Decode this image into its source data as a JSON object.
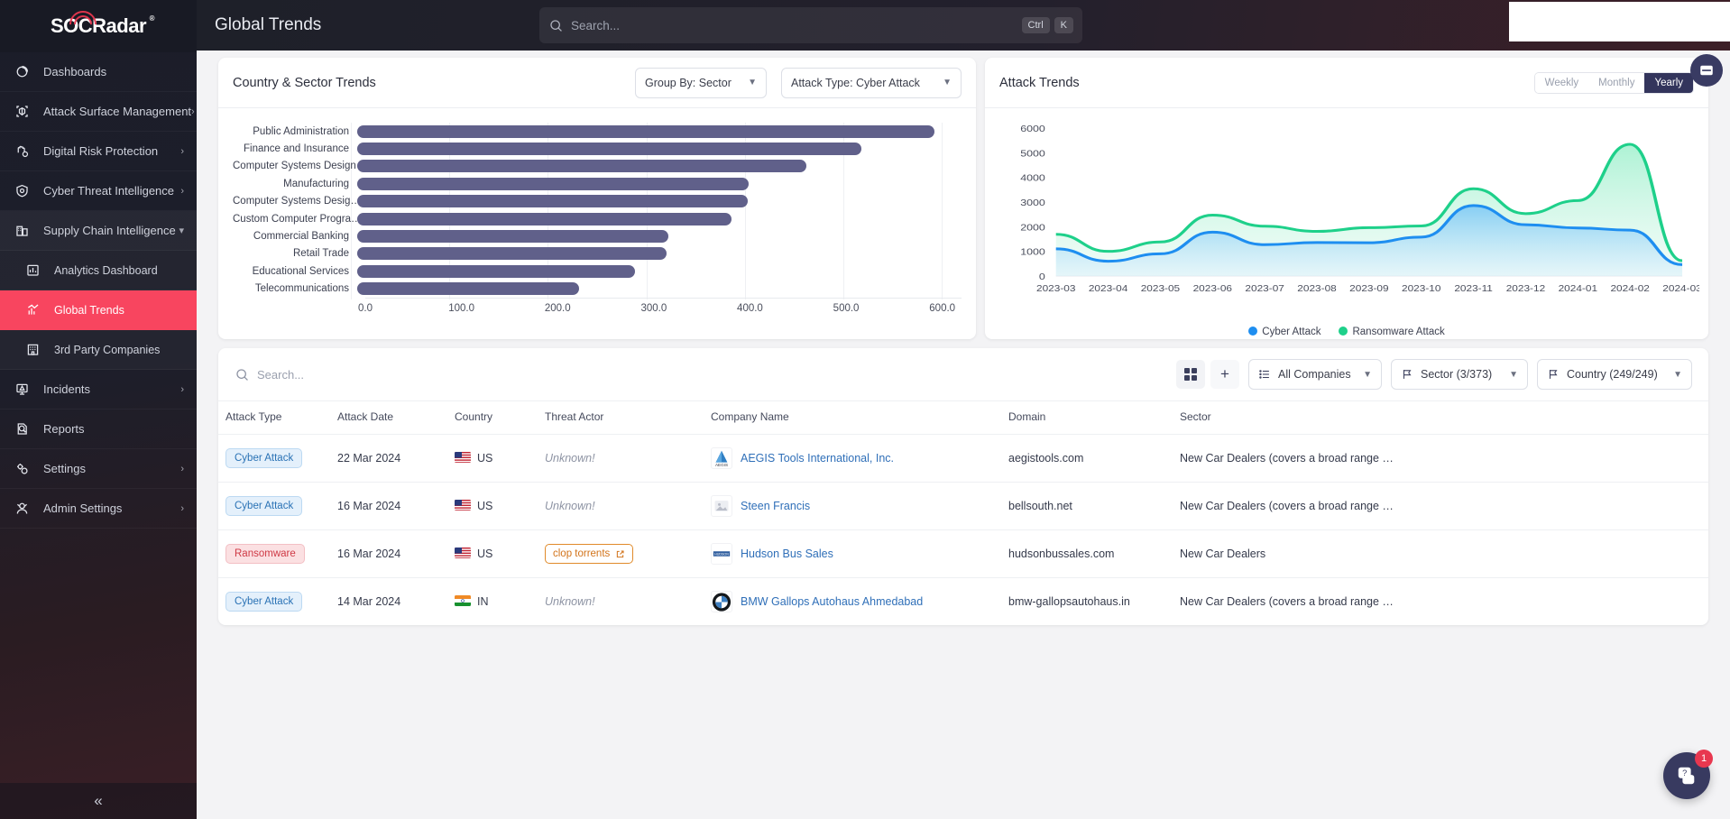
{
  "brand": {
    "name": "SOCRadar",
    "reg": "®",
    "accent": "#f8455f"
  },
  "topbar": {
    "page_title": "Global Trends",
    "search_placeholder": "Search...",
    "kbd_ctrl": "Ctrl",
    "kbd_k": "K"
  },
  "sidebar": {
    "collapse_glyph": "«",
    "items": [
      {
        "label": "Dashboards",
        "icon": "dashboard-icon",
        "chevron": "",
        "state": ""
      },
      {
        "label": "Attack Surface Management",
        "icon": "asm-icon",
        "chevron": "›",
        "state": ""
      },
      {
        "label": "Digital Risk Protection",
        "icon": "drp-icon",
        "chevron": "›",
        "state": ""
      },
      {
        "label": "Cyber Threat Intelligence",
        "icon": "cti-icon",
        "chevron": "›",
        "state": ""
      },
      {
        "label": "Supply Chain Intelligence",
        "icon": "supply-icon",
        "chevron": "⌄",
        "state": "open"
      },
      {
        "label": "Analytics Dashboard",
        "icon": "analytics-icon",
        "chevron": "",
        "state": "child"
      },
      {
        "label": "Global Trends",
        "icon": "trends-icon",
        "chevron": "",
        "state": "child active"
      },
      {
        "label": "3rd Party Companies",
        "icon": "companies-icon",
        "chevron": "",
        "state": "child"
      },
      {
        "label": "Incidents",
        "icon": "incidents-icon",
        "chevron": "›",
        "state": ""
      },
      {
        "label": "Reports",
        "icon": "reports-icon",
        "chevron": "",
        "state": ""
      },
      {
        "label": "Settings",
        "icon": "settings-icon",
        "chevron": "›",
        "state": ""
      },
      {
        "label": "Admin Settings",
        "icon": "admin-icon",
        "chevron": "›",
        "state": ""
      }
    ]
  },
  "sector_card": {
    "title": "Country & Sector Trends",
    "group_by": "Group By: Sector",
    "attack_type": "Attack Type: Cyber Attack"
  },
  "trends_card": {
    "title": "Attack Trends",
    "ranges": [
      {
        "label": "Weekly",
        "active": false
      },
      {
        "label": "Monthly",
        "active": false
      },
      {
        "label": "Yearly",
        "active": true
      }
    ]
  },
  "filterbar": {
    "search_placeholder": "Search...",
    "grid_button": "grid-view-button",
    "add_button": "+",
    "all_companies": "All Companies",
    "sector_filter": "Sector (3/373)",
    "country_filter": "Country (249/249)"
  },
  "table": {
    "columns": [
      "Attack Type",
      "Attack Date",
      "Country",
      "Threat Actor",
      "Company Name",
      "Domain",
      "Sector"
    ],
    "rows": [
      {
        "attack_type": "Cyber Attack",
        "attack_kind": "cyber",
        "attack_date": "22 Mar 2024",
        "country": "US",
        "flag": "us",
        "threat_actor": "Unknown!",
        "actor_known": false,
        "company": "AEGIS Tools International, Inc.",
        "logo": "AEGIS",
        "domain": "aegistools.com",
        "sector": "New Car Dealers (covers a broad range …"
      },
      {
        "attack_type": "Cyber Attack",
        "attack_kind": "cyber",
        "attack_date": "16 Mar 2024",
        "country": "US",
        "flag": "us",
        "threat_actor": "Unknown!",
        "actor_known": false,
        "company": "Steen Francis",
        "logo": "",
        "domain": "bellsouth.net",
        "sector": "New Car Dealers (covers a broad range …"
      },
      {
        "attack_type": "Ransomware",
        "attack_kind": "ransom",
        "attack_date": "16 Mar 2024",
        "country": "US",
        "flag": "us",
        "threat_actor": "clop torrents",
        "actor_known": true,
        "company": "Hudson Bus Sales",
        "logo": "HUDSON",
        "domain": "hudsonbussales.com",
        "sector": "New Car Dealers"
      },
      {
        "attack_type": "Cyber Attack",
        "attack_kind": "cyber",
        "attack_date": "14 Mar 2024",
        "country": "IN",
        "flag": "in",
        "threat_actor": "Unknown!",
        "actor_known": false,
        "company": "BMW Gallops Autohaus Ahmedabad",
        "logo": "BMW",
        "domain": "bmw-gallopsautohaus.in",
        "sector": "New Car Dealers (covers a broad range …"
      }
    ]
  },
  "help_widget": {
    "badge": "1",
    "icon": "help-chat-icon"
  },
  "chart_data": [
    {
      "type": "bar",
      "title": "Country & Sector Trends",
      "orientation": "horizontal",
      "xlabel": "",
      "ylabel": "",
      "xlim": [
        0,
        620
      ],
      "grid": true,
      "tick_labels": [
        "0.0",
        "100.0",
        "200.0",
        "300.0",
        "400.0",
        "500.0",
        "600.0"
      ],
      "ticks": [
        0,
        100,
        200,
        300,
        400,
        500,
        600
      ],
      "categories": [
        "Public Administration",
        "Finance and Insurance",
        "Computer Systems Design…",
        "Manufacturing",
        "Computer Systems Desig…",
        "Custom Computer Progra…",
        "Commercial Banking",
        "Retail Trade",
        "Educational Services",
        "Telecommunications"
      ],
      "values": [
        592,
        517,
        461,
        402,
        401,
        384,
        319,
        317,
        285,
        228
      ],
      "bar_color": "#60608a"
    },
    {
      "type": "area",
      "title": "Attack Trends",
      "xlabel": "",
      "ylabel": "",
      "ylim": [
        0,
        6000
      ],
      "ytick_labels": [
        "0",
        "1000",
        "2000",
        "3000",
        "4000",
        "5000",
        "6000"
      ],
      "yticks": [
        0,
        1000,
        2000,
        3000,
        4000,
        5000,
        6000
      ],
      "grid": false,
      "legend_position": "bottom",
      "x": [
        "2023-03",
        "2023-04",
        "2023-05",
        "2023-06",
        "2023-07",
        "2023-08",
        "2023-09",
        "2023-10",
        "2023-11",
        "2023-12",
        "2024-01",
        "2024-02",
        "2024-03"
      ],
      "series": [
        {
          "name": "Cyber Attack",
          "color": "#1e8ef0",
          "values": [
            1100,
            600,
            900,
            1780,
            1270,
            1360,
            1350,
            1580,
            2860,
            2080,
            1950,
            1860,
            460
          ]
        },
        {
          "name": "Ransomware Attack",
          "color": "#1ed08a",
          "values": [
            1690,
            1000,
            1380,
            2470,
            2020,
            1810,
            1960,
            2030,
            3540,
            2530,
            3060,
            5340,
            620
          ]
        }
      ]
    }
  ]
}
